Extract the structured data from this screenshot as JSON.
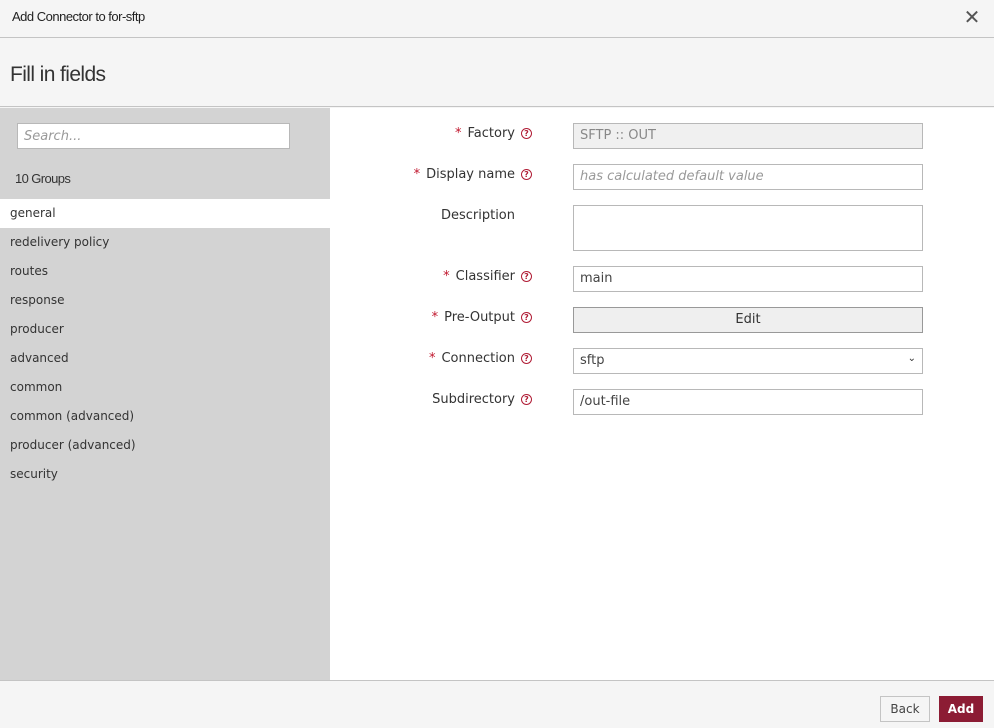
{
  "window": {
    "title": "Add Connector to for-sftp",
    "close_icon": "close-icon"
  },
  "header": {
    "title": "Fill in fields"
  },
  "sidebar": {
    "search_placeholder": "Search...",
    "groups_count": "10 Groups",
    "groups": [
      {
        "label": "general",
        "active": true
      },
      {
        "label": "redelivery policy",
        "active": false
      },
      {
        "label": "routes",
        "active": false
      },
      {
        "label": "response",
        "active": false
      },
      {
        "label": "producer",
        "active": false
      },
      {
        "label": "advanced",
        "active": false
      },
      {
        "label": "common",
        "active": false
      },
      {
        "label": "common (advanced)",
        "active": false
      },
      {
        "label": "producer (advanced)",
        "active": false
      },
      {
        "label": "security",
        "active": false
      }
    ]
  },
  "form": {
    "required_marker": "*",
    "help_glyph": "?",
    "fields": {
      "factory": {
        "label": "Factory",
        "required": true,
        "value": "SFTP :: OUT",
        "readonly": true
      },
      "display_name": {
        "label": "Display name",
        "required": true,
        "value": "",
        "placeholder": "has calculated default value"
      },
      "description": {
        "label": "Description",
        "required": false,
        "value": ""
      },
      "classifier": {
        "label": "Classifier",
        "required": true,
        "value": "main"
      },
      "pre_output": {
        "label": "Pre-Output",
        "required": true,
        "button_label": "Edit"
      },
      "connection": {
        "label": "Connection",
        "required": true,
        "value": "sftp",
        "chevron": "⌄"
      },
      "subdirectory": {
        "label": "Subdirectory",
        "required": false,
        "value": "/out-file"
      }
    }
  },
  "footer": {
    "back_label": "Back",
    "add_label": "Add"
  },
  "colors": {
    "accent": "#8c1c34",
    "required": "#c0142b",
    "sidebar_bg": "#d3d3d3"
  }
}
